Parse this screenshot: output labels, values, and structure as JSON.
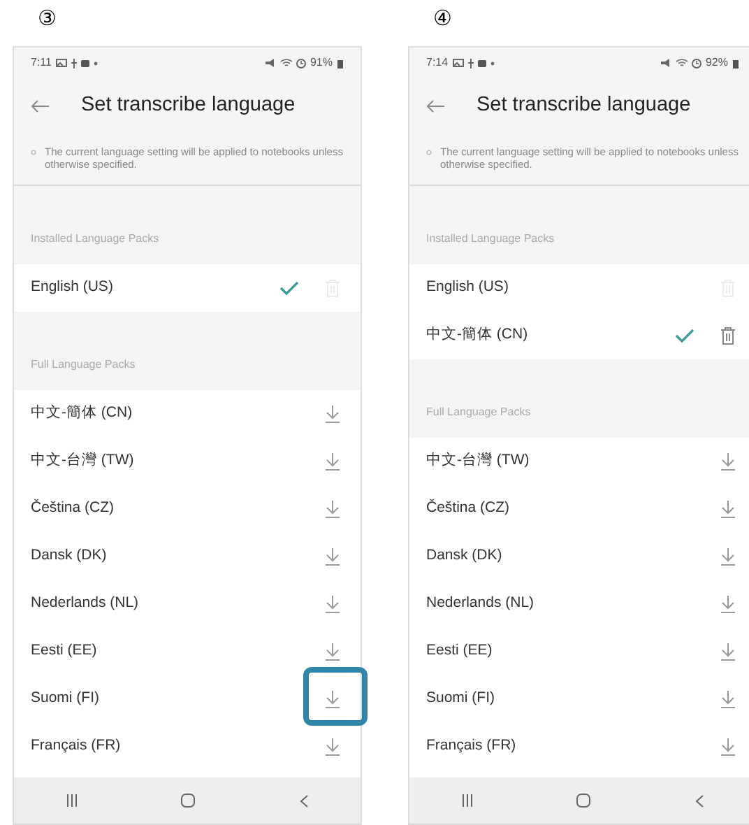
{
  "screens": [
    {
      "step": "③",
      "status_bar": {
        "time": "7:11",
        "battery": "91%"
      },
      "title": "Set transcribe language",
      "notice": "The current language setting will be applied to notebooks unless otherwise specified.",
      "installed": {
        "heading": "Installed Language Packs",
        "items": [
          {
            "label": "English (US)",
            "selected": true,
            "delete_disabled": true
          }
        ]
      },
      "full": {
        "heading": "Full Language Packs",
        "items": [
          {
            "label": "中文-簡体 (CN)",
            "highlighted": false
          },
          {
            "label": "中文-台灣 (TW)",
            "highlighted": false
          },
          {
            "label": "Čeština (CZ)",
            "highlighted": false
          },
          {
            "label": "Dansk (DK)",
            "highlighted": false
          },
          {
            "label": "Nederlands (NL)",
            "highlighted": false
          },
          {
            "label": "Eesti (EE)",
            "highlighted": false
          },
          {
            "label": "Suomi (FI)",
            "highlighted": true
          },
          {
            "label": "Français (FR)",
            "highlighted": false
          }
        ]
      }
    },
    {
      "step": "④",
      "status_bar": {
        "time": "7:14",
        "battery": "92%"
      },
      "title": "Set transcribe language",
      "notice": "The current language setting will be applied to notebooks unless otherwise specified.",
      "installed": {
        "heading": "Installed Language Packs",
        "items": [
          {
            "label": "English (US)",
            "selected": false,
            "delete_disabled": true
          },
          {
            "label": "中文-簡体 (CN)",
            "selected": true,
            "delete_disabled": false
          }
        ]
      },
      "full": {
        "heading": "Full Language Packs",
        "items": [
          {
            "label": "中文-台灣 (TW)",
            "highlighted": false
          },
          {
            "label": "Čeština (CZ)",
            "highlighted": false
          },
          {
            "label": "Dansk (DK)",
            "highlighted": false
          },
          {
            "label": "Nederlands (NL)",
            "highlighted": false
          },
          {
            "label": "Eesti (EE)",
            "highlighted": false
          },
          {
            "label": "Suomi (FI)",
            "highlighted": false
          },
          {
            "label": "Français (FR)",
            "highlighted": false
          }
        ]
      }
    }
  ]
}
